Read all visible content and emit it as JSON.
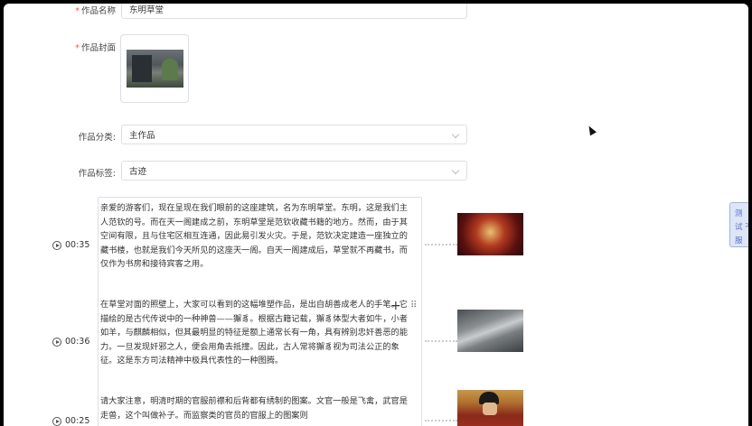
{
  "form": {
    "title_label": "作品名称",
    "title_value": "东明草堂",
    "cover_label": "作品封面",
    "category_label": "作品分类:",
    "category_value": "主作品",
    "tag_label": "作品标签:",
    "tag_value": "古迹"
  },
  "segments": [
    {
      "time": "00:35",
      "text": "亲爱的游客们，现在呈现在我们眼前的这座建筑，名为东明草堂。东明，这是我们主人范钦的号。而在天一阁建成之前，东明草堂是范钦收藏书籍的地方。然而，由于其空间有限，且与住宅区相互连通，因此易引发火灾。于是，范钦决定建造一座独立的藏书楼，也就是我们今天所见的这座天一阁。自天一阁建成后，草堂就不再藏书，而仅作为书房和接待宾客之用。",
      "image_icon": "hall-interior-photo"
    },
    {
      "time": "00:36",
      "text": "在草堂对面的照壁上，大家可以看到的这幅堆塑作品，是出自胡善成老人的手笔。它描绘的是古代传说中的一种神兽——獬豸。根据古籍记载，獬豸体型大者如牛，小者如羊，与麒麟相似，但其最明显的特征是额上通常长有一角，具有辨别忠奸善恶的能力。一旦发现奸邪之人，便会用角去抵撞。因此，古人常将獬豸视为司法公正的象征。这是东方司法精神中极具代表性的一种图腾。",
      "image_icon": "relief-sculpture-photo"
    },
    {
      "time": "00:25",
      "text": "请大家注意，明清时期的官服前襟和后背都有绣制的图案。文官一般是飞禽，武官是走兽，这个叫做补子。而监察类的官员的官服上的图案则",
      "image_icon": "official-portrait-photo"
    }
  ],
  "side_tab": {
    "chars": [
      "测",
      "试",
      "服"
    ],
    "arrow": ">"
  }
}
